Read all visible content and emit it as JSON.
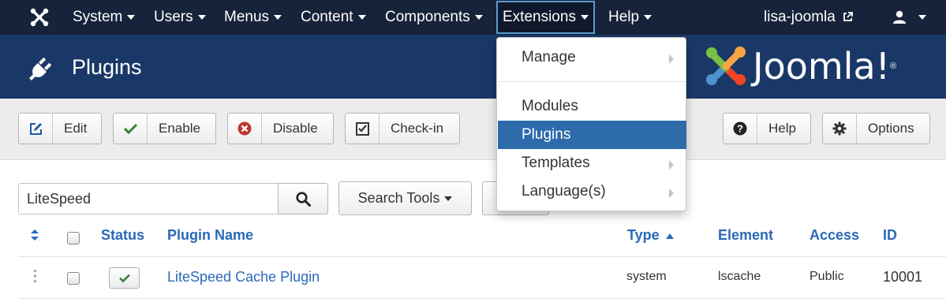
{
  "navbar": {
    "menu": [
      {
        "label": "System"
      },
      {
        "label": "Users"
      },
      {
        "label": "Menus"
      },
      {
        "label": "Content"
      },
      {
        "label": "Components"
      },
      {
        "label": "Extensions"
      },
      {
        "label": "Help"
      }
    ],
    "site_link": "lisa-joomla",
    "user_icon": "user-icon",
    "logo_icon": "joomla-icon"
  },
  "header": {
    "title": "Plugins",
    "icon": "plug-icon",
    "brand": "Joomla!",
    "brand_mark": "®"
  },
  "toolbar": {
    "edit": "Edit",
    "enable": "Enable",
    "disable": "Disable",
    "checkin": "Check-in",
    "help": "Help",
    "options": "Options"
  },
  "filters": {
    "search_value": "LiteSpeed",
    "search_tools": "Search Tools"
  },
  "table": {
    "headers": {
      "status": "Status",
      "name": "Plugin Name",
      "type": "Type",
      "element": "Element",
      "access": "Access",
      "id": "ID"
    },
    "rows": [
      {
        "name": "LiteSpeed Cache Plugin",
        "type": "system",
        "element": "lscache",
        "access": "Public",
        "id": "10001"
      }
    ]
  },
  "dropdown": {
    "items": [
      {
        "label": "Manage"
      },
      {
        "label": "Modules"
      },
      {
        "label": "Plugins"
      },
      {
        "label": "Templates"
      },
      {
        "label": "Language(s)"
      }
    ]
  },
  "colors": {
    "navbar": "#17233a",
    "header": "#1a3867",
    "link": "#2a69b8",
    "active_menu": "#2d6bab"
  }
}
